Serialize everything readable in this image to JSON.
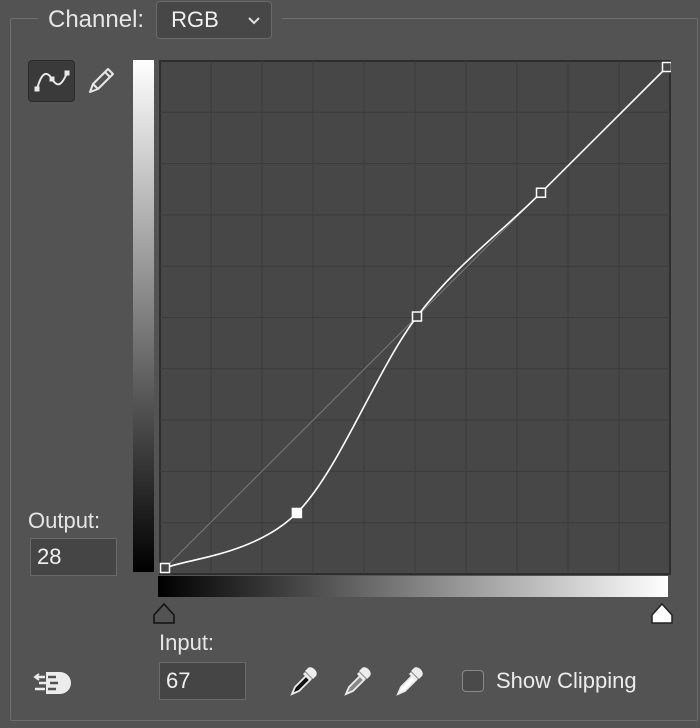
{
  "channel": {
    "label": "Channel:",
    "value": "RGB"
  },
  "tools": {
    "curve_tool": "curve-point-icon",
    "pencil_tool": "pencil-icon"
  },
  "output": {
    "label": "Output:",
    "value": "28"
  },
  "input": {
    "label": "Input:",
    "value": "67"
  },
  "show_clipping": {
    "label": "Show Clipping",
    "checked": false
  },
  "eyedroppers": [
    "black-point-eyedropper-icon",
    "gray-point-eyedropper-icon",
    "white-point-eyedropper-icon"
  ],
  "curve": {
    "points": [
      [
        0,
        0
      ],
      [
        67,
        28
      ],
      [
        128,
        128
      ],
      [
        191,
        191
      ],
      [
        255,
        255
      ]
    ],
    "selected_index": 1
  },
  "colors": {
    "background": "#535353",
    "graph_bg": "#474747",
    "curve": "#ffffff"
  }
}
